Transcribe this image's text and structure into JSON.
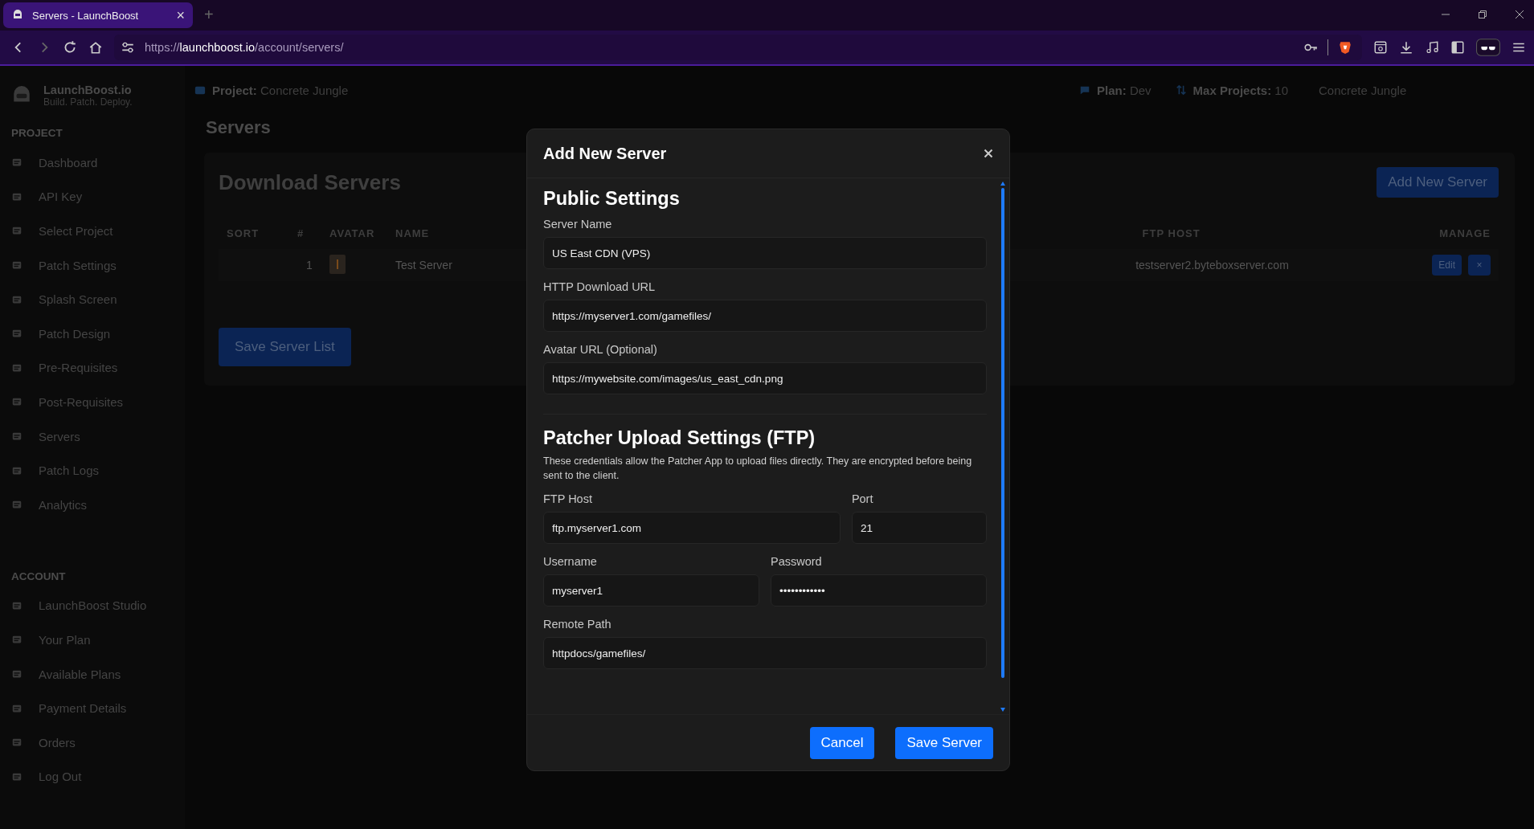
{
  "browser": {
    "tab": {
      "title": "Servers - LaunchBoost",
      "close": "×"
    },
    "new_tab": "+",
    "url": {
      "scheme": "https://",
      "host": "launchboost.io",
      "path": "/account/servers/"
    }
  },
  "sidebar": {
    "brand": {
      "name": "LaunchBoost.io",
      "tagline": "Build. Patch. Deploy."
    },
    "sections": [
      {
        "title": "PROJECT",
        "items": [
          {
            "label": "Dashboard"
          },
          {
            "label": "API Key"
          },
          {
            "label": "Select Project"
          },
          {
            "label": "Patch Settings"
          },
          {
            "label": "Splash Screen"
          },
          {
            "label": "Patch Design"
          },
          {
            "label": "Pre-Requisites"
          },
          {
            "label": "Post-Requisites"
          },
          {
            "label": "Servers"
          },
          {
            "label": "Patch Logs"
          },
          {
            "label": "Analytics"
          }
        ]
      },
      {
        "title": "ACCOUNT",
        "items": [
          {
            "label": "LaunchBoost Studio"
          },
          {
            "label": "Your Plan"
          },
          {
            "label": "Available Plans"
          },
          {
            "label": "Payment Details"
          },
          {
            "label": "Orders"
          },
          {
            "label": "Log Out"
          }
        ]
      }
    ]
  },
  "header": {
    "project": {
      "label": "Project:",
      "value": "Concrete Jungle"
    },
    "plan": {
      "label": "Plan:",
      "value": "Dev"
    },
    "max_projects": {
      "label": "Max Projects:",
      "value": "10"
    },
    "project_menu": "Concrete Jungle"
  },
  "page_title": "Servers",
  "card": {
    "title": "Download Servers",
    "add_button": "Add New Server",
    "columns_left": [
      "SORT",
      "#",
      "AVATAR",
      "NAME"
    ],
    "columns_right": [
      "FTP HOST",
      "MANAGE"
    ],
    "rows": [
      {
        "number": "1",
        "name": "Test Server",
        "ftp_host": "testserver2.byteboxserver.com",
        "edit": "Edit",
        "delete": "×"
      }
    ],
    "save_button": "Save Server List"
  },
  "modal": {
    "title": "Add New Server",
    "public": {
      "heading": "Public Settings",
      "fields": [
        {
          "label": "Server Name",
          "value": "US East CDN (VPS)"
        },
        {
          "label": "HTTP Download URL",
          "value": "https://myserver1.com/gamefiles/"
        },
        {
          "label": "Avatar URL (Optional)",
          "value": "https://mywebsite.com/images/us_east_cdn.png"
        }
      ]
    },
    "ftp": {
      "heading": "Patcher Upload Settings (FTP)",
      "note": "These credentials allow the Patcher App to upload files directly. They are encrypted before being sent to the client.",
      "rows": [
        [
          {
            "label": "FTP Host",
            "value": "ftp.myserver1.com",
            "kind": "wide"
          },
          {
            "label": "Port",
            "value": "21",
            "kind": "narrow"
          }
        ],
        [
          {
            "label": "Username",
            "value": "myserver1",
            "kind": "half"
          },
          {
            "label": "Password",
            "value": "••••••••••••",
            "kind": "half"
          }
        ],
        [
          {
            "label": "Remote Path",
            "value": "httpdocs/gamefiles/",
            "kind": "full"
          }
        ]
      ]
    },
    "buttons": {
      "cancel": "Cancel",
      "save": "Save Server"
    }
  }
}
